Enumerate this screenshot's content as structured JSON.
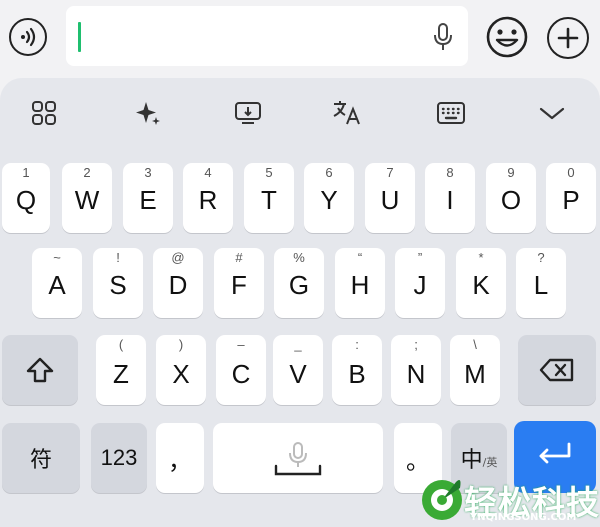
{
  "input": {
    "value": "",
    "placeholder": ""
  },
  "toolbar": {
    "icons": [
      "apps-grid-icon",
      "sparkle-icon",
      "screen-icon",
      "translate-icon",
      "keyboard-icon",
      "chevron-down-icon"
    ]
  },
  "row1": [
    {
      "hint": "1",
      "label": "Q"
    },
    {
      "hint": "2",
      "label": "W"
    },
    {
      "hint": "3",
      "label": "E"
    },
    {
      "hint": "4",
      "label": "R"
    },
    {
      "hint": "5",
      "label": "T"
    },
    {
      "hint": "6",
      "label": "Y"
    },
    {
      "hint": "7",
      "label": "U"
    },
    {
      "hint": "8",
      "label": "I"
    },
    {
      "hint": "9",
      "label": "O"
    },
    {
      "hint": "0",
      "label": "P"
    }
  ],
  "row2": [
    {
      "hint": "~",
      "label": "A"
    },
    {
      "hint": "!",
      "label": "S"
    },
    {
      "hint": "@",
      "label": "D"
    },
    {
      "hint": "#",
      "label": "F"
    },
    {
      "hint": "%",
      "label": "G"
    },
    {
      "hint": "“",
      "label": "H"
    },
    {
      "hint": "”",
      "label": "J"
    },
    {
      "hint": "*",
      "label": "K"
    },
    {
      "hint": "?",
      "label": "L"
    }
  ],
  "row3": [
    {
      "hint": "(",
      "label": "Z"
    },
    {
      "hint": ")",
      "label": "X"
    },
    {
      "hint": "–",
      "label": "C"
    },
    {
      "hint": "_",
      "label": "V"
    },
    {
      "hint": ":",
      "label": "B"
    },
    {
      "hint": ";",
      "label": "N"
    },
    {
      "hint": "\\",
      "label": "M"
    }
  ],
  "row4": {
    "symbols": "符",
    "numbers": "123",
    "comma": "，",
    "period": "。",
    "lang_main": "中",
    "lang_sub": "/英"
  },
  "watermark": {
    "text": "轻松科技",
    "sub": "YNQINGSONG.COM"
  },
  "colors": {
    "accent": "#2a7df2",
    "caret": "#1fbf6f",
    "keyboard_bg": "#e5e7ec"
  }
}
